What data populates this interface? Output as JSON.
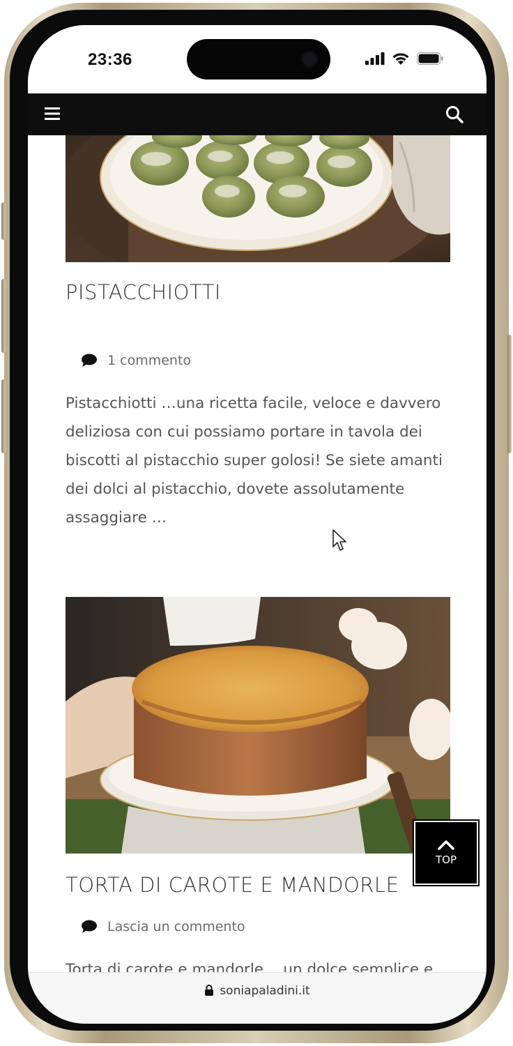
{
  "status_bar": {
    "time": "23:36"
  },
  "header": {
    "menu_icon": "hamburger-icon",
    "search_icon": "search-icon",
    "background": "#0e0e0e"
  },
  "posts": [
    {
      "title": "PISTACCHIOTTI",
      "comments": "1 commento",
      "excerpt": "Pistacchiotti …una ricetta facile, veloce e davvero deliziosa con cui possiamo portare in tavola dei biscotti al pistacchio super golosi! Se siete amanti dei dolci al pistacchio, dovete assolutamente assaggiare …"
    },
    {
      "title": "TORTA DI CAROTE E MANDORLE",
      "comments": "Lascia un commento",
      "excerpt": "Torta di carote e mandorle …un dolce semplice e genuino. Ecco una torta facile e"
    }
  ],
  "top_button": {
    "label": "TOP"
  },
  "url_bar": {
    "domain": "soniapaladini.it"
  },
  "colors": {
    "text": "#555555",
    "title": "#333333",
    "meta": "#6a6a6a"
  }
}
